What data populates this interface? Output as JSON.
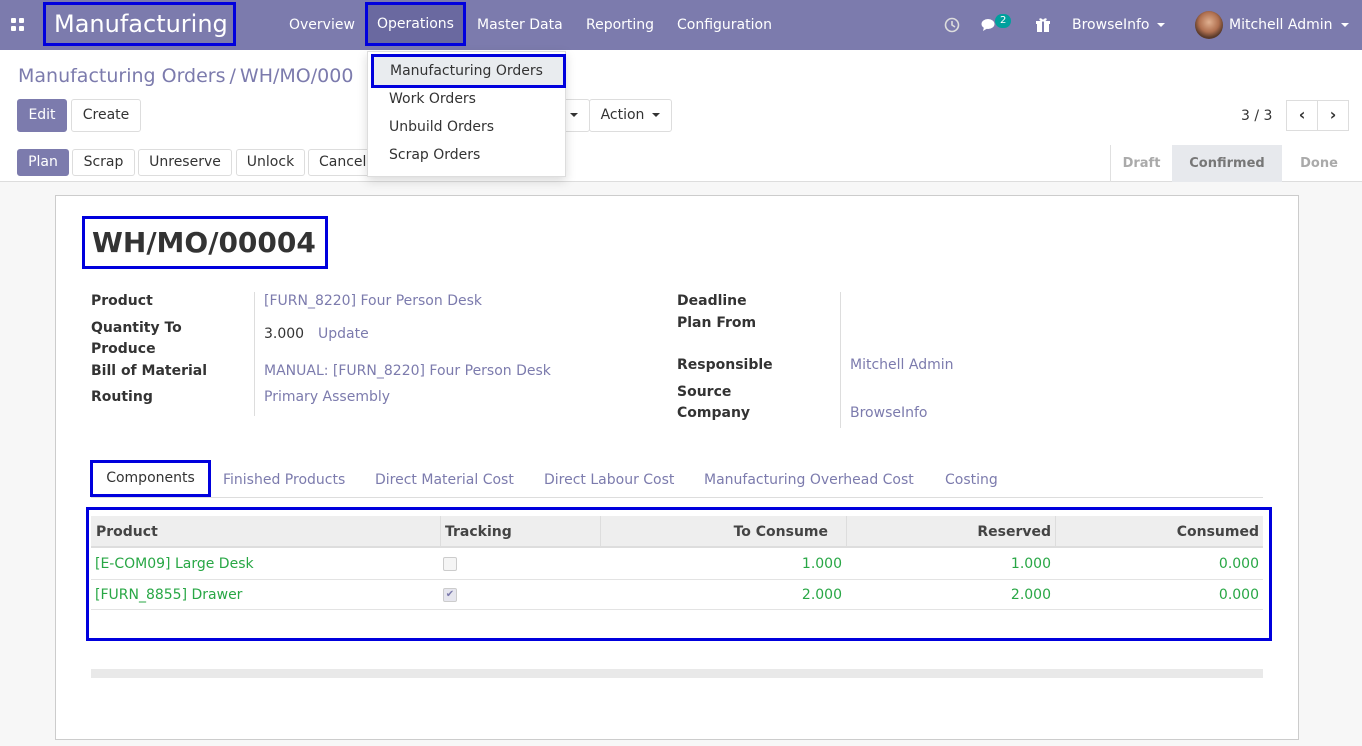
{
  "navbar": {
    "brand": "Manufacturing",
    "menu": [
      "Overview",
      "Operations",
      "Master Data",
      "Reporting",
      "Configuration"
    ],
    "chat_count": "2",
    "company": "BrowseInfo",
    "user": "Mitchell Admin"
  },
  "breadcrumb": {
    "parent": "Manufacturing Orders",
    "separator": "/",
    "current": "WH/MO/000"
  },
  "buttons": {
    "edit": "Edit",
    "create": "Create",
    "action": "Action",
    "plan": "Plan",
    "scrap": "Scrap",
    "unreserve": "Unreserve",
    "unlock": "Unlock",
    "cancel": "Cancel"
  },
  "pager": {
    "text": "3 / 3"
  },
  "statusbar": {
    "steps": [
      "Draft",
      "Confirmed",
      "Done"
    ],
    "active": "Confirmed"
  },
  "dropdown": {
    "items": [
      "Manufacturing Orders",
      "Work Orders",
      "Unbuild Orders",
      "Scrap Orders"
    ]
  },
  "form": {
    "title": "WH/MO/00004",
    "fields_left": [
      {
        "label": "Product",
        "value": "[FURN_8220] Four Person Desk"
      },
      {
        "label": "Quantity To Produce",
        "value": "3.000",
        "action": "Update"
      },
      {
        "label": "Bill of Material",
        "value": "MANUAL: [FURN_8220] Four Person Desk"
      },
      {
        "label": "Routing",
        "value": "Primary Assembly"
      }
    ],
    "fields_right": [
      {
        "label": "Deadline",
        "value": ""
      },
      {
        "label": "Plan From",
        "value": ""
      },
      {
        "label": "Responsible",
        "value": "Mitchell Admin"
      },
      {
        "label": "Source Company",
        "value": "BrowseInfo"
      }
    ]
  },
  "tabs": [
    "Components",
    "Finished Products",
    "Direct Material Cost",
    "Direct Labour Cost",
    "Manufacturing Overhead Cost",
    "Costing"
  ],
  "table": {
    "columns": [
      "Product",
      "Tracking",
      "To Consume",
      "Reserved",
      "Consumed"
    ],
    "rows": [
      {
        "product": "[E-COM09] Large Desk",
        "tracking": false,
        "to_consume": "1.000",
        "reserved": "1.000",
        "consumed": "0.000"
      },
      {
        "product": "[FURN_8855] Drawer",
        "tracking": true,
        "to_consume": "2.000",
        "reserved": "2.000",
        "consumed": "0.000"
      }
    ]
  }
}
